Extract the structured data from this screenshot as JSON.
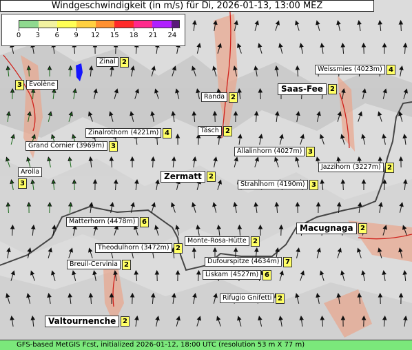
{
  "title": "Windgeschwindigkeit (in m/s) für Di, 2026-01-13, 13:00 MEZ",
  "legend": {
    "ticks": [
      "0",
      "3",
      "6",
      "9",
      "12",
      "15",
      "18",
      "21",
      "24"
    ],
    "colors": [
      "#8fd98f",
      "#f2f2a0",
      "#ffff55",
      "#ffd040",
      "#ff9030",
      "#ff2a2a",
      "#ff2a8c",
      "#b020ff",
      "#5a1a7a"
    ]
  },
  "places": [
    {
      "name": "Zinal",
      "value": "2"
    },
    {
      "name": "Evolène",
      "value": "3"
    },
    {
      "name": "Weissmies (4023m)",
      "value": "4"
    },
    {
      "name": "Saas-Fee",
      "value": "2",
      "big": true
    },
    {
      "name": "Randa",
      "value": "2"
    },
    {
      "name": "Täsch",
      "value": "2"
    },
    {
      "name": "Zinalrothorn (4221m)",
      "value": "4"
    },
    {
      "name": "Grand Cornier (3969m)",
      "value": "3"
    },
    {
      "name": "Allalinhorn (4027m)",
      "value": "3"
    },
    {
      "name": "Jazzihorn (3227m)",
      "value": "2"
    },
    {
      "name": "Arolla",
      "value": "3"
    },
    {
      "name": "Zermatt",
      "value": "2",
      "big": true
    },
    {
      "name": "Strahlhorn (4190m)",
      "value": "3"
    },
    {
      "name": "Matterhorn (4478m)",
      "value": "6"
    },
    {
      "name": "Macugnaga",
      "value": "2",
      "big": true
    },
    {
      "name": "Monte-Rosa-Hütte",
      "value": "2"
    },
    {
      "name": "Theodulhorn (3472m)",
      "value": "2"
    },
    {
      "name": "Dufourspitze (4634m)",
      "value": "7"
    },
    {
      "name": "Breuil-Cervinia",
      "value": "2"
    },
    {
      "name": "Liskam (4527m)",
      "value": "6"
    },
    {
      "name": "Rifugio Gnifetti",
      "value": "2"
    },
    {
      "name": "Valtournenche",
      "value": "2",
      "big": true
    }
  ],
  "footer": "GFS-based MetGIS Fcst, initialized 2026-01-12, 18:00 UTC  (resolution 53 m X 77 m)"
}
